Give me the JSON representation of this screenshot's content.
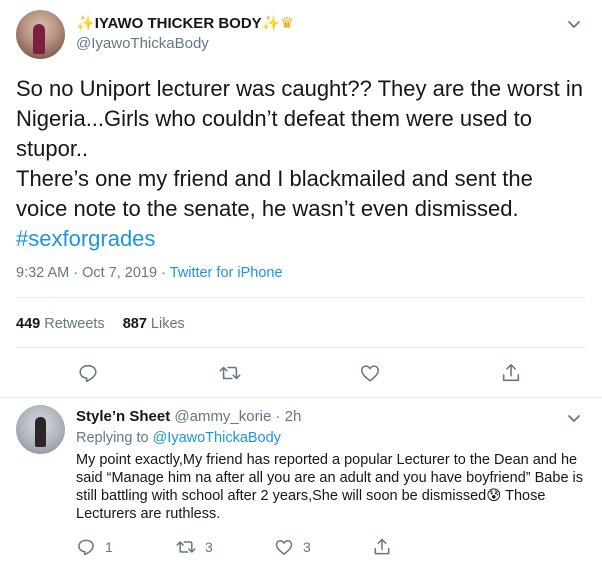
{
  "colors": {
    "accent": "#1b95e0",
    "secondary_text": "#657786",
    "border": "#e6ecf0"
  },
  "main_tweet": {
    "display_name": "IYAWO THICKER BODY",
    "handle": "@IyawoThickaBody",
    "text_lines": [
      "So no Uniport lecturer was caught?? They are the worst in Nigeria...Girls who couldn’t defeat them were used to stupor..",
      "There’s one my friend and I blackmailed and sent the voice note to the senate, he wasn’t even dismissed."
    ],
    "hashtag": "#sexforgrades",
    "time": "9:32 AM",
    "date": "Oct 7, 2019",
    "source": "Twitter for iPhone",
    "retweets_count": "449",
    "retweets_label": "Retweets",
    "likes_count": "887",
    "likes_label": "Likes",
    "icons": [
      "reply-icon",
      "retweet-icon",
      "like-icon",
      "share-icon"
    ]
  },
  "reply": {
    "display_name": "Style’n Sheet",
    "handle": "@ammy_korie",
    "time": "2h",
    "replying_label": "Replying to",
    "replying_to": "@IyawoThickaBody",
    "text": "My point exactly,My friend has reported a popular Lecturer to the Dean and he said “Manage him na after all you are an adult and you have boyfriend” Babe is still battling with school after 2 years,She will soon be dismissed😰 Those Lecturers are ruthless.",
    "reply_count": "1",
    "retweet_count": "3",
    "like_count": "3"
  }
}
